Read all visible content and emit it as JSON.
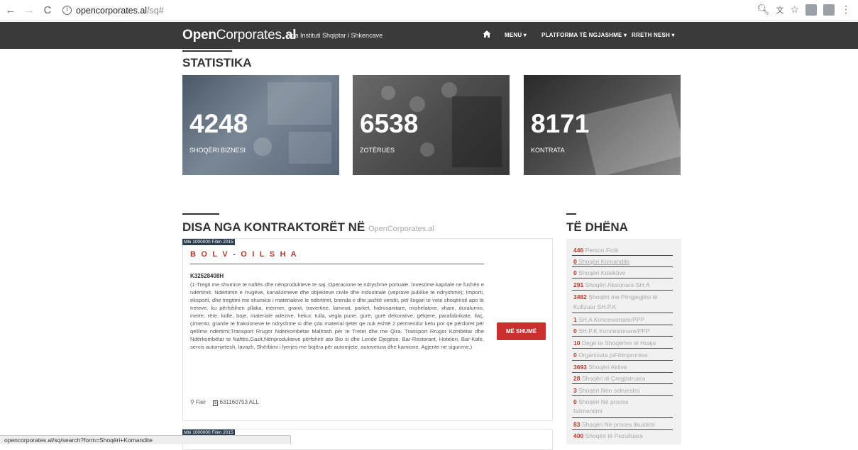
{
  "browser": {
    "url_host": "opencorporates.al",
    "url_path": "/sq#"
  },
  "navbar": {
    "brand_bold": "Open",
    "brand_light": "Corporates",
    "brand_tld": ".al",
    "tagline": "Nga Instituti Shqiptar i Shkencave",
    "menu_menu": "MENU",
    "menu_platforms": "PLATFORMA TË NGJASHME",
    "menu_about": "RRETH NESH"
  },
  "stats": {
    "heading": "STATISTIKA",
    "cards": [
      {
        "number": "4248",
        "label": "SHOQËRI BIZNESI"
      },
      {
        "number": "6538",
        "label": "ZOTËRUES"
      },
      {
        "number": "8171",
        "label": "KONTRATA"
      }
    ]
  },
  "contractors": {
    "heading": "DISA NGA KONTRAKTORËT NË",
    "heading_sub": "OpenCorporates.al",
    "items": [
      {
        "tag": "Mbi 1000000 Fitim 2015",
        "name": "B O L V - O I L S H A",
        "nipt": "K32528408H",
        "description": "(1-Tregti me shumice te naftës dhe nënprodukteve te saj. Operacione te ndryshme portuale. Investime kapitale ne fushën e ndërtimit. Ndertimin e rrugëve, kanalizimeve dhe objekteve civile dhe industriale (veprave publike te ndryshme); Importi, eksporti, dhe tregtimi me shumice i materialeve le ndërtimit, brenda e dhe jashtë vendit, për llogari te vete shoqërisë apo te treteve, ku përfshihen pllaka, mermer, granit, travertine, laminat, parket, hidrosanitare, mishelatore, xham, duralumin, inerte, rëre, kolle, boje, materiale adezive, hekur, tulla, vegla pune, gurë, gurë dekorative, gëlqere, parafabrikate, ilaç, çimento, granile te fraksioneve te ndryshme si dhe çdo material tjetër qe nuk është 2 përmendur ketu por qe përdoret për qellime ndërtimi;Transport Rrugor Ndërkombëtar Mallrash për te Tretet dhe me Qira. Transport Rrugor Kombëtar dhe Ndërkombëtar te Naftës,Gazit,Nënprodukteve përfshirë ato Bio si dhe Lende Djegëse. Bar-Restorant, Hoteleri, Bar-Kafe, servis automjetesh, lavazh, Shërbimi i lyerjes me bojëra për automjete, autovetura dhe kamione. Agjente ne sigurime.)",
        "city": "Fier",
        "amount": "631160753 ALL",
        "button": "MË SHUMË"
      },
      {
        "tag": "Mbi 1000000 Fitim 2015"
      }
    ]
  },
  "sidebar": {
    "heading": "TË DHËNA",
    "items": [
      {
        "count": "446",
        "label": "Person Fizik"
      },
      {
        "count": "0",
        "label": "Shoqëri Komandite"
      },
      {
        "count": "0",
        "label": "Shoqëri Kolektive"
      },
      {
        "count": "291",
        "label": "Shoqëri Aksionare SH.A"
      },
      {
        "count": "3482",
        "label": "Shoqëri me Përgjegjësi të",
        "label2": "Kufizuar SH.P.K"
      },
      {
        "count": "1",
        "label": "SH.A Koncesionare/PPP"
      },
      {
        "count": "0",
        "label": "SH.P.K Koncesionare/PPP"
      },
      {
        "count": "10",
        "label": "Degë te Shoqërive të Huaja"
      },
      {
        "count": "0",
        "label": "Organizata joFitimprurëse"
      },
      {
        "count": "3693",
        "label": "Shoqëri Aktive"
      },
      {
        "count": "28",
        "label": "Shoqëri të Çregjistruara"
      },
      {
        "count": "3",
        "label": "Shoqëri Nën sekuestro"
      },
      {
        "count": "0",
        "label": "Shoqëri Në proces",
        "label2": "falimentimi"
      },
      {
        "count": "83",
        "label": "Shoqëri Në proces likuidimi"
      },
      {
        "count": "400",
        "label": "Shoqëri të Pezulluara"
      }
    ]
  },
  "status_bar": "opencorporates.al/sq/search?form=Shoqëri+Komandite"
}
